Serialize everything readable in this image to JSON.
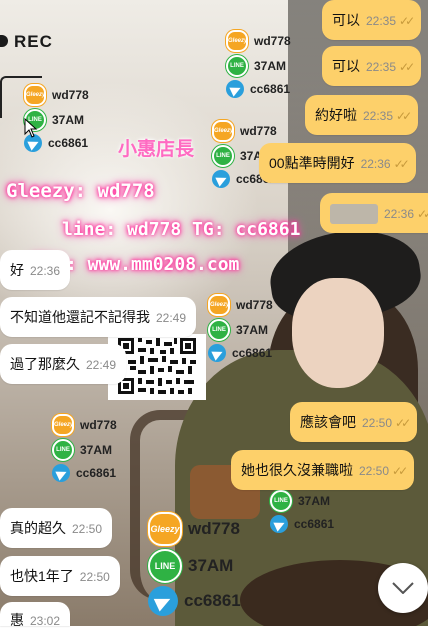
{
  "overlay": {
    "rec": "REC",
    "name": "小惠店長",
    "gleezy_line": "Gleezy: wd778",
    "line_tg": "line: wd778 TG: cc6861",
    "website_line": "網址: www.mm0208.com",
    "contacts": {
      "gleezy": "wd778",
      "line": "37AM",
      "telegram": "cc6861"
    },
    "icon_labels": {
      "gleezy": "Gleezy",
      "line": "LINE"
    }
  },
  "chat": {
    "outgoing": [
      {
        "text": "可以",
        "time": "22:35"
      },
      {
        "text": "可以",
        "time": "22:35"
      },
      {
        "text": "約好啦",
        "time": "22:35"
      },
      {
        "text": "00點準時開好",
        "time": "22:36"
      },
      {
        "text": "",
        "time": "22:36"
      },
      {
        "text": "應該會吧",
        "time": "22:50"
      },
      {
        "text": "她也很久沒兼職啦",
        "time": "22:50"
      }
    ],
    "incoming": [
      {
        "text": "好",
        "time": "22:36"
      },
      {
        "text": "不知道他還記不記得我",
        "time": "22:49"
      },
      {
        "text": "過了那麼久",
        "time": "22:49"
      },
      {
        "text": "真的超久",
        "time": "22:50"
      },
      {
        "text": "也快1年了",
        "time": "22:50"
      },
      {
        "text": "惠",
        "time": "23:02"
      }
    ],
    "read_mark": "✓✓"
  },
  "colors": {
    "outgoing": "#fdd06a",
    "incoming": "#ffffff",
    "watermark_glow": "#ff2d9a"
  }
}
